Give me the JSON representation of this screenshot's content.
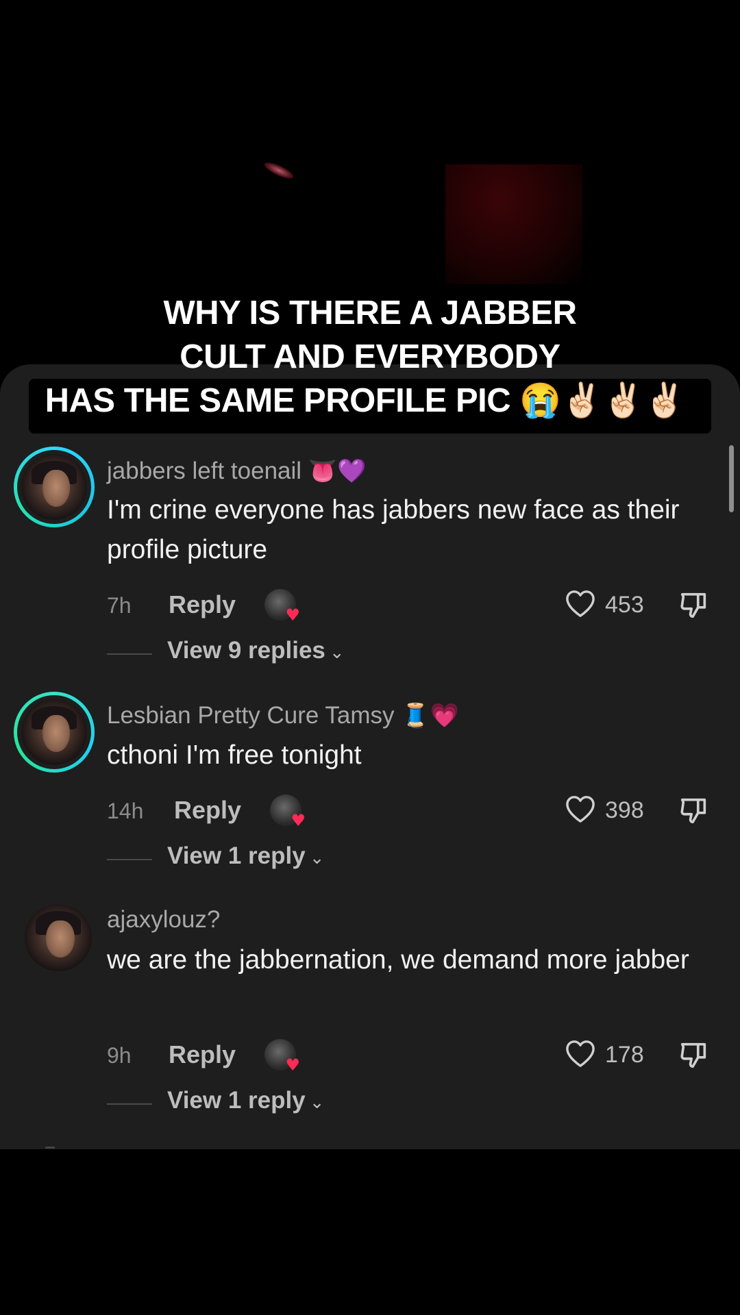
{
  "caption": {
    "line1": "WHY IS THERE A JABBER",
    "line2": "CULT AND EVERYBODY",
    "line3": "HAS THE SAME PROFILE PIC 😭✌🏻✌🏻✌🏻"
  },
  "comments": [
    {
      "username": "jabbers left toenail",
      "username_emoji": "👅💜",
      "text": "I'm crine everyone has jabbers new face as their profile picture",
      "time": "7h",
      "reply_label": "Reply",
      "likes": "453",
      "view_replies": "View 9 replies"
    },
    {
      "username": "Lesbian Pretty Cure Tamsy",
      "username_emoji": "🧵💗",
      "text": "cthoni I'm free tonight",
      "time": "14h",
      "reply_label": "Reply",
      "likes": "398",
      "view_replies": "View 1 reply"
    },
    {
      "username": "ajaxylouz?",
      "username_emoji": "",
      "text": "we are the jabbernation, we demand more jabber",
      "time": "9h",
      "reply_label": "Reply",
      "likes": "178",
      "view_replies": "View 1 reply"
    }
  ],
  "icons": {
    "like": "heart-outline-icon",
    "dislike": "thumbs-down-icon",
    "chevron": "chevron-down-icon",
    "creator_liked": "creator-heart-avatar-icon"
  },
  "colors": {
    "panel": "#1e1e1e",
    "ring_blue": "#2fd8ff",
    "ring_green": "#28e49a",
    "creator_heart": "#ff2a55"
  }
}
